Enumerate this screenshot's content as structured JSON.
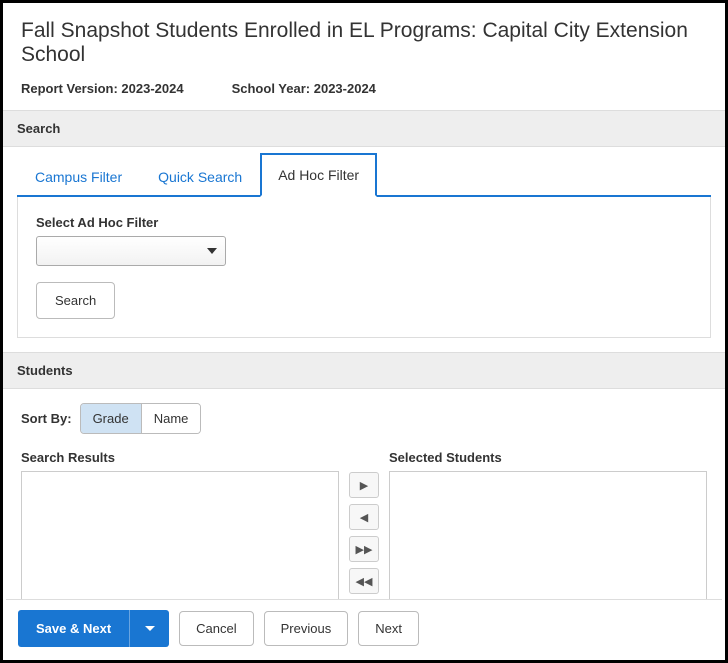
{
  "page_title": "Fall Snapshot Students Enrolled in EL Programs: Capital City Extension School",
  "meta": {
    "report_version_label": "Report Version:",
    "report_version_value": "2023-2024",
    "school_year_label": "School Year:",
    "school_year_value": "2023-2024"
  },
  "search_section": {
    "header": "Search",
    "tabs": {
      "campus_filter": "Campus Filter",
      "quick_search": "Quick Search",
      "ad_hoc_filter": "Ad Hoc Filter"
    },
    "adhoc": {
      "field_label": "Select Ad Hoc Filter",
      "selected_value": "",
      "search_button": "Search"
    }
  },
  "students_section": {
    "header": "Students",
    "sort_by_label": "Sort By:",
    "sort_options": {
      "grade": "Grade",
      "name": "Name"
    },
    "search_results_label": "Search Results",
    "selected_students_label": "Selected Students"
  },
  "footer": {
    "save_next": "Save & Next",
    "cancel": "Cancel",
    "previous": "Previous",
    "next": "Next"
  }
}
